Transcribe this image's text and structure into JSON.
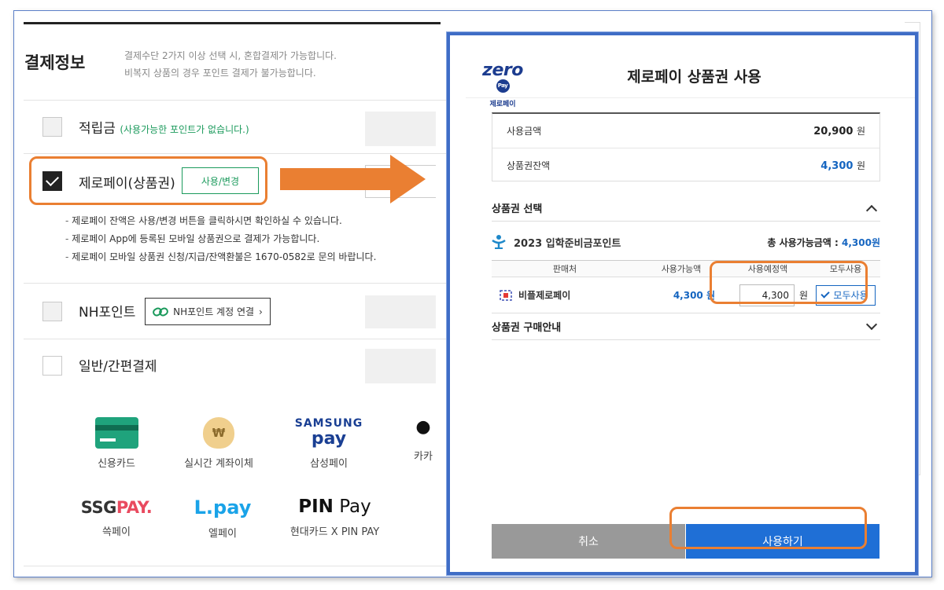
{
  "payment": {
    "title": "결제정보",
    "desc_line1": "결제수단 2가지 이상 선택 시, 혼합결제가 가능합니다.",
    "desc_line2": "비복지 상품의 경우 포인트 결제가 불가능합니다.",
    "points_label": "적립금",
    "points_note": "(사용가능한 포인트가 없습니다.)",
    "zeropay_label": "제로페이(상품권)",
    "zeropay_button": "사용/변경",
    "notes": [
      "제로페이 잔액은 사용/변경 버튼을 클릭하시면 확인하실 수 있습니다.",
      "제로페이 App에 등록된 모바일 상품권으로 결제가 가능합니다.",
      "제로페이 모바일 상품권 신청/지급/잔액환불은 1670-0582로 문의 바랍니다."
    ],
    "nh_label": "NH포인트",
    "nh_button": "NH포인트 계정 연결",
    "general_label": "일반/간편결제",
    "methods": {
      "card": "신용카드",
      "transfer": "실시간 계좌이체",
      "samsung_logo_1": "SAMSUNG",
      "samsung_logo_2": "pay",
      "samsung": "삼성페이",
      "kakao_logo": "●",
      "kakao": "카카",
      "ssg_logo_a": "SSG",
      "ssg_logo_b": "PAY.",
      "ssg": "쓱페이",
      "lpay_logo": "L.pay",
      "lpay": "엘페이",
      "pin_logo_a": "PIN",
      "pin_logo_b": " Pay",
      "pin": "현대카드 X PIN PAY"
    }
  },
  "modal": {
    "logo_text": "zero",
    "logo_badge": "Pay",
    "logo_sub": "제로페이",
    "title": "제로페이 상품권 사용",
    "summary": {
      "use_amount_label": "사용금액",
      "use_amount_value": "20,900",
      "balance_label": "상품권잔액",
      "balance_value": "4,300",
      "unit": "원"
    },
    "select_header": "상품권 선택",
    "voucher_name": "2023 입학준비금포인트",
    "total_label": "총 사용가능금액 : ",
    "total_value": "4,300원",
    "table_headers": [
      "판매처",
      "사용가능액",
      "사용예정액",
      "모두사용"
    ],
    "row": {
      "seller": "비플제로페이",
      "available": "4,300 원",
      "planned": "4,300",
      "unit": "원",
      "use_all": "모두사용"
    },
    "guide_header": "상품권 구매안내",
    "cancel": "취소",
    "confirm": "사용하기"
  },
  "colors": {
    "highlight": "#ea7f32",
    "modal_border": "#3f6dc6",
    "accent_blue": "#1f6fd6",
    "green": "#1b9a5c"
  }
}
